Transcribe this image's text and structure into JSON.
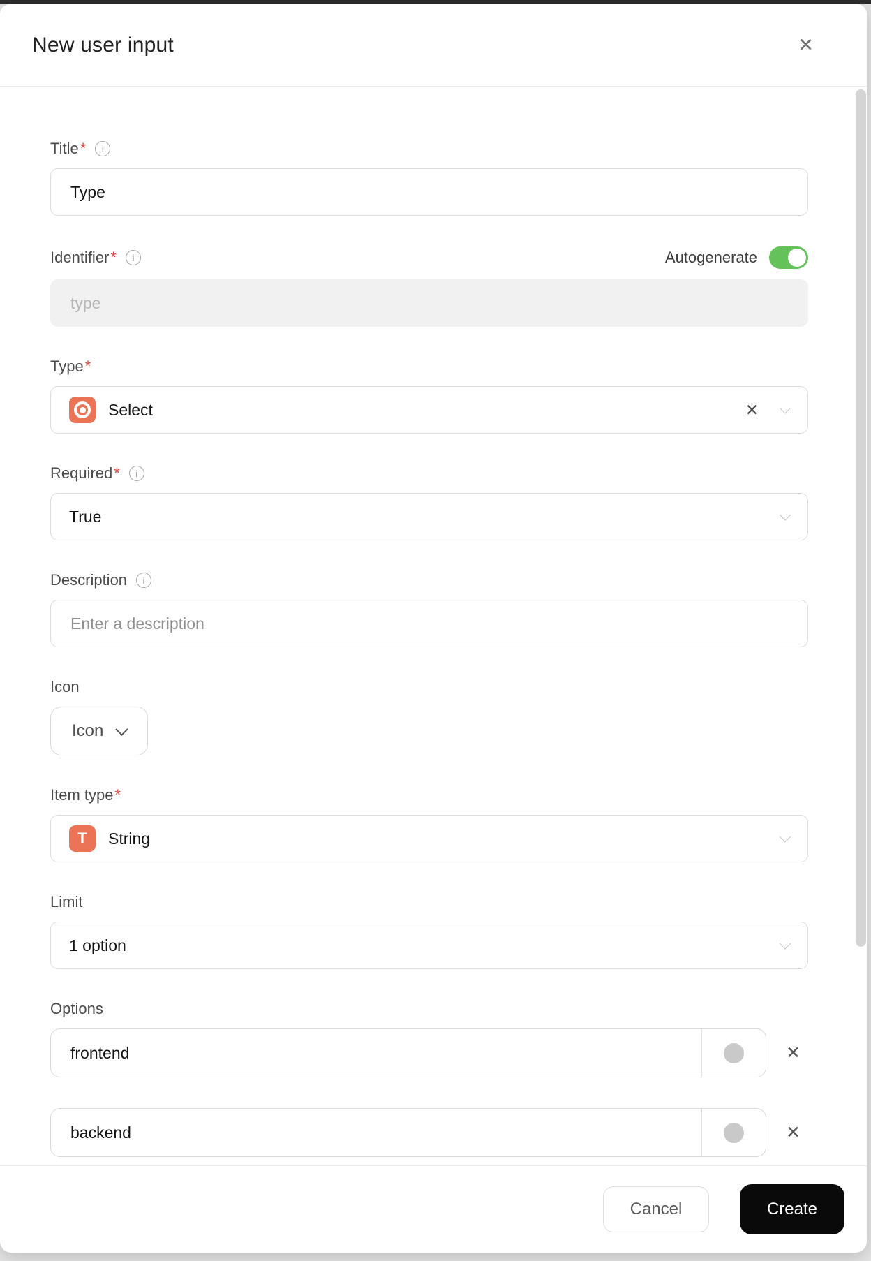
{
  "modal": {
    "title": "New user input"
  },
  "ui": {
    "required_marker": "*",
    "info_glyph": "i",
    "close_glyph": "✕",
    "clear_glyph": "✕",
    "remove_glyph": "✕"
  },
  "fields": {
    "title": {
      "label": "Title",
      "value": "Type"
    },
    "identifier": {
      "label": "Identifier",
      "placeholder": "type",
      "autogenerate_label": "Autogenerate",
      "autogenerate_on": true
    },
    "type": {
      "label": "Type",
      "value": "Select"
    },
    "required": {
      "label": "Required",
      "value": "True"
    },
    "description": {
      "label": "Description",
      "placeholder": "Enter a description"
    },
    "icon": {
      "label": "Icon",
      "button_label": "Icon"
    },
    "item_type": {
      "label": "Item type",
      "value": "String",
      "badge_letter": "T"
    },
    "limit": {
      "label": "Limit",
      "value": "1 option"
    },
    "options": {
      "label": "Options",
      "items": [
        {
          "value": "frontend"
        },
        {
          "value": "backend"
        }
      ]
    }
  },
  "footer": {
    "cancel_label": "Cancel",
    "create_label": "Create"
  },
  "colors": {
    "accent_salmon": "#EB7457",
    "toggle_green": "#65C15A",
    "asterisk_red": "#E0443F",
    "swatch_gray": "#C9C9C9",
    "create_button_bg": "#0A0A0A"
  }
}
